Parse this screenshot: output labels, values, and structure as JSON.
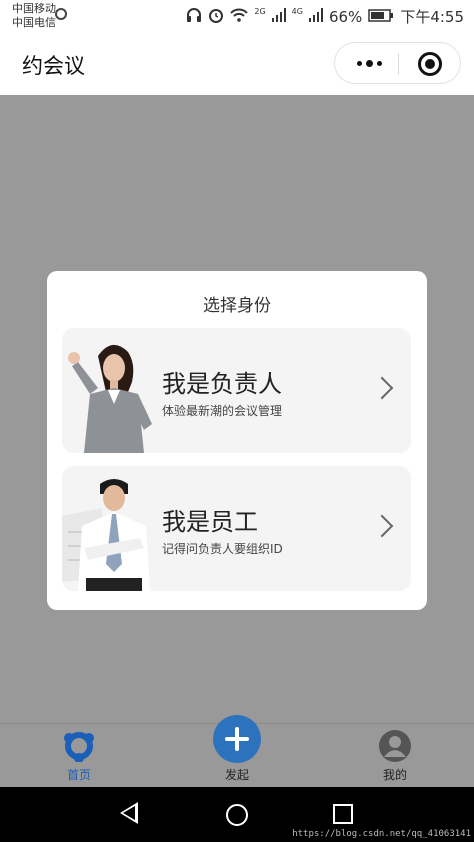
{
  "status_bar": {
    "carrier_1": "中国移动",
    "carrier_2": "中国电信",
    "network_2g": "2G",
    "network_4g": "4G",
    "battery": "66%",
    "time": "下午4:55"
  },
  "nav": {
    "title": "约会议"
  },
  "modal": {
    "title": "选择身份",
    "options": [
      {
        "title": "我是负责人",
        "subtitle": "体验最新潮的会议管理"
      },
      {
        "title": "我是员工",
        "subtitle": "记得问负责人要组织ID"
      }
    ]
  },
  "tabbar": {
    "items": [
      {
        "label": "首页",
        "icon": "share-network-icon",
        "active": true
      },
      {
        "label": "发起",
        "icon": "plus-icon",
        "active": false
      },
      {
        "label": "我的",
        "icon": "user-avatar-icon",
        "active": false
      }
    ]
  },
  "watermark": "https://blog.csdn.net/qq_41063141",
  "colors": {
    "accent": "#2d72bd",
    "overlay": "#999999",
    "card": "#f4f4f4"
  }
}
